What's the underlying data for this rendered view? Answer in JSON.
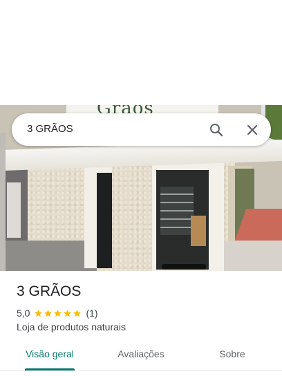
{
  "search": {
    "query": "3 GRÃOS",
    "search_icon": "search-icon",
    "close_icon": "close-icon"
  },
  "photo": {
    "sign_text": "Grãos"
  },
  "place": {
    "name": "3 GRÃOS",
    "rating": "5,0",
    "stars": 5,
    "review_count": "(1)",
    "category": "Loja de produtos naturais"
  },
  "tabs": [
    {
      "label": "Visão geral",
      "active": true
    },
    {
      "label": "Avaliações",
      "active": false
    },
    {
      "label": "Sobre",
      "active": false
    }
  ],
  "colors": {
    "accent": "#00796b",
    "star": "#fbbc04",
    "text_primary": "#202124",
    "text_secondary": "#3c4043"
  }
}
